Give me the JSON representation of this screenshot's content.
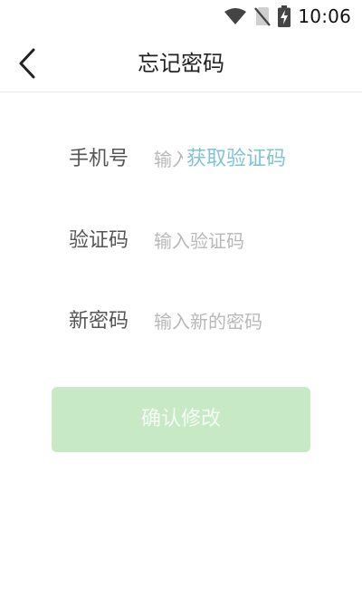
{
  "status_bar": {
    "time": "10:06",
    "icons": [
      "wifi-icon",
      "no-sim-icon",
      "battery-charging-icon"
    ]
  },
  "app_bar": {
    "title": "忘记密码",
    "back_icon": "chevron-left-icon"
  },
  "form": {
    "phone": {
      "label": "手机号",
      "placeholder": "输入手机号",
      "get_code_label": "获取验证码"
    },
    "code": {
      "label": "验证码",
      "placeholder": "输入验证码"
    },
    "new_password": {
      "label": "新密码",
      "placeholder": "输入新的密码"
    }
  },
  "confirm_button": {
    "label": "确认修改",
    "bg_color": "#c7e9c6"
  },
  "colors": {
    "link": "#7fc4d6",
    "label": "#555555",
    "placeholder": "#b8b8b8"
  }
}
